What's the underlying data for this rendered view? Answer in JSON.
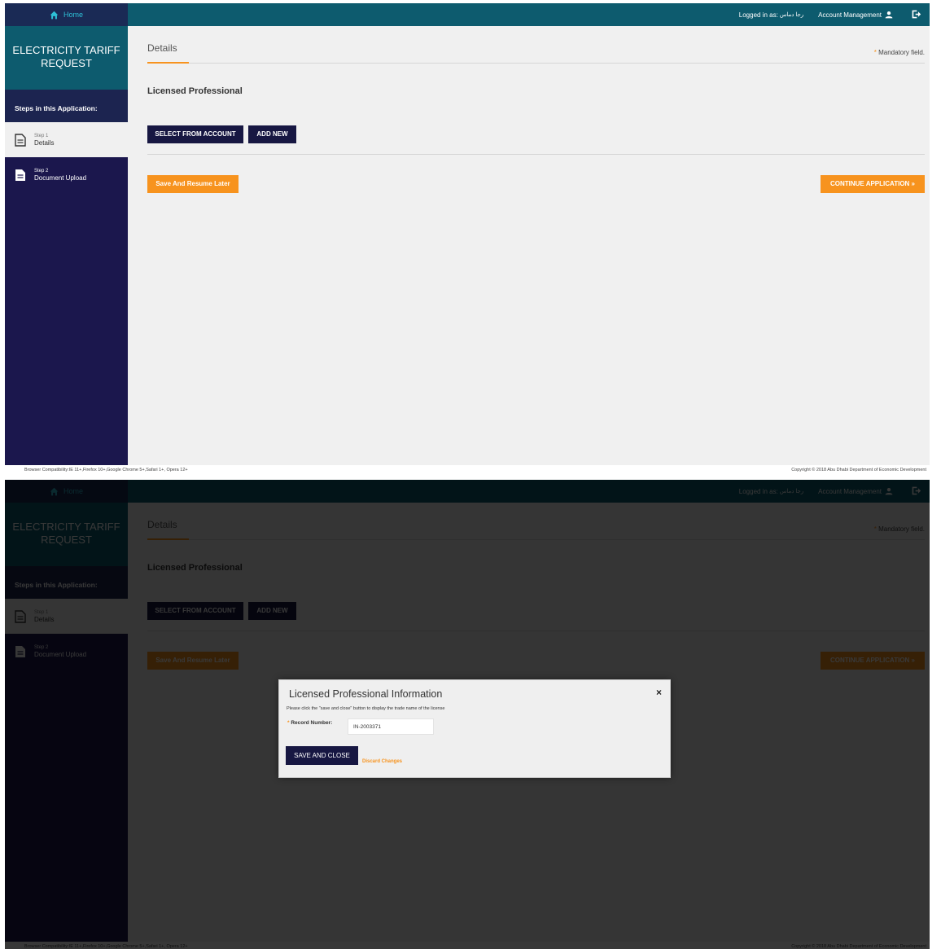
{
  "header": {
    "home_label": "Home",
    "logged_in_label": "Logged in as:",
    "logged_in_user": "رجا دماس",
    "account_management_label": "Account Management"
  },
  "sidebar": {
    "app_title": "ELECTRICITY TARIFF REQUEST",
    "steps_heading": "Steps in this Application:",
    "steps": [
      {
        "number": "Step 1",
        "name": "Details"
      },
      {
        "number": "Step 2",
        "name": "Document Upload"
      }
    ]
  },
  "main": {
    "tab_label": "Details",
    "mandatory_note": "Mandatory field.",
    "section_title": "Licensed Professional",
    "select_from_account_label": "SELECT FROM ACCOUNT",
    "add_new_label": "ADD NEW",
    "save_resume_label": "Save And Resume Later",
    "continue_label": "CONTINUE APPLICATION »"
  },
  "footer": {
    "compatibility": "Browser Compatibility:IE 11+,Firefox 10+,Google Chrome 5+,Safari 1+, Opera 12+",
    "copyright": "Copyright © 2018 Abu Dhabi Department of Economic Development"
  },
  "modal": {
    "title": "Licensed Professional Information",
    "close_label": "×",
    "instruction": "Please click the \"save and close\" button to display the trade name of the license",
    "record_label": "Record Number:",
    "record_value": "IN-2003371",
    "save_close_label": "SAVE AND CLOSE",
    "discard_label": "Discard Changes"
  },
  "colors": {
    "teal_header": "#0d5b6e",
    "sidebar_navy": "#1b174d",
    "button_dark": "#171742",
    "accent_orange": "#f7931e"
  }
}
